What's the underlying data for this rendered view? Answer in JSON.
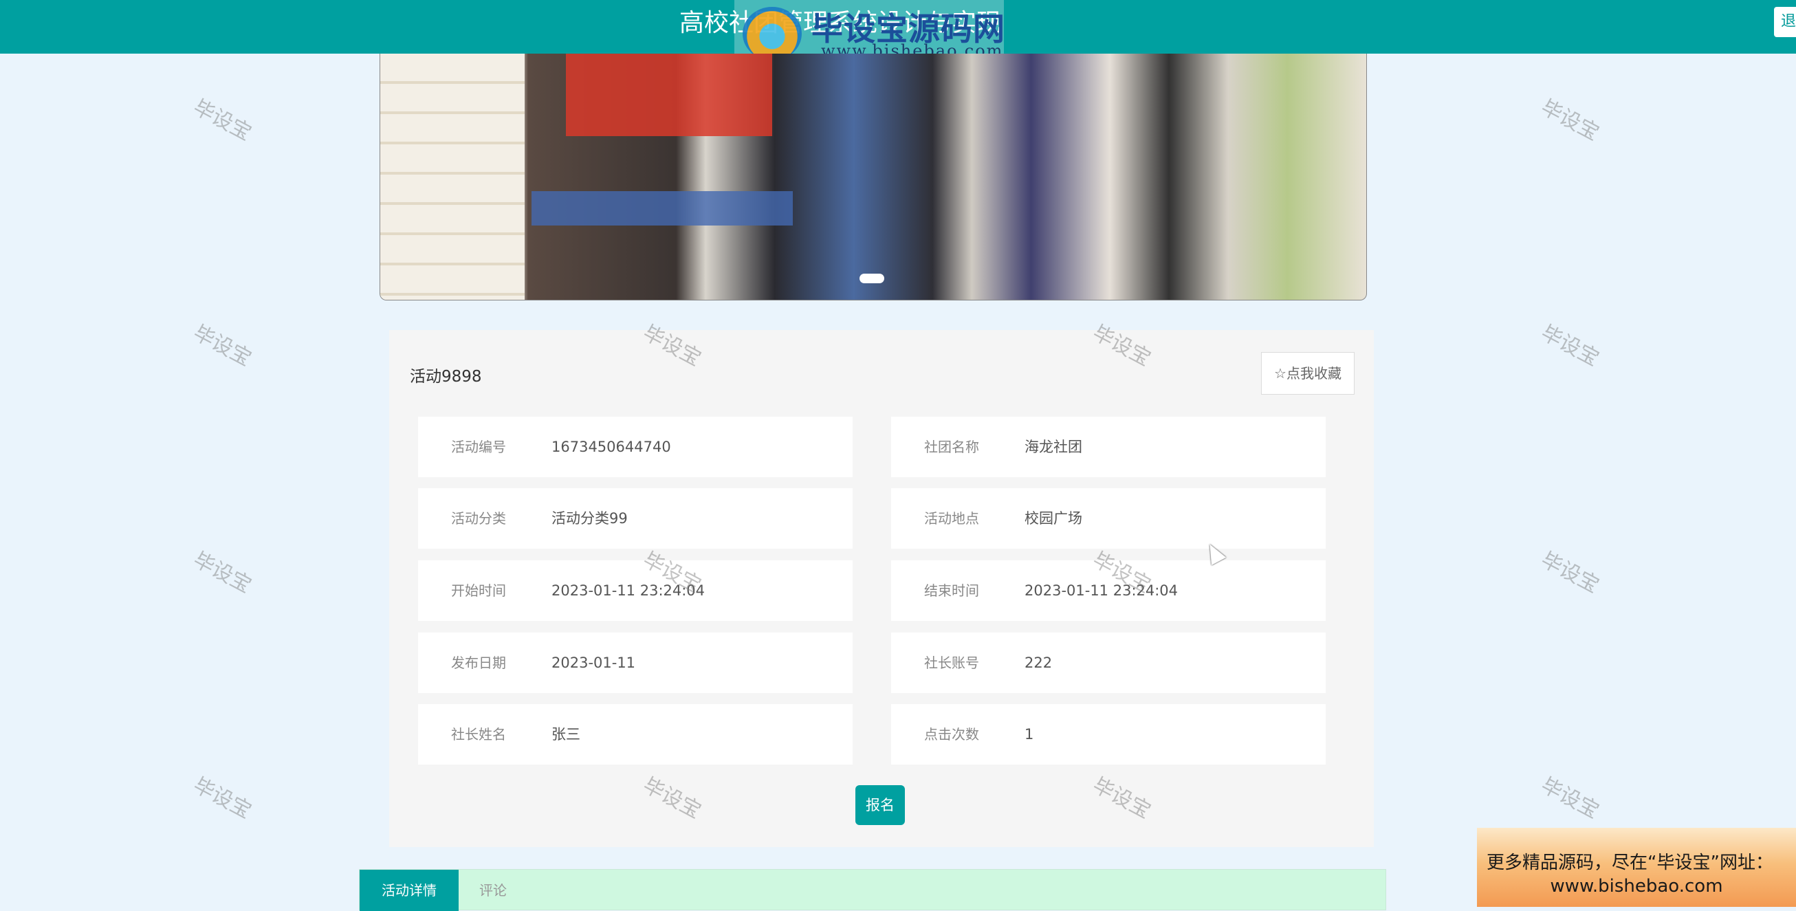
{
  "header": {
    "title": "高校社团管理系统设计与实现",
    "logout_label": "退出"
  },
  "logo_overlay": {
    "brand": "毕设宝源码网",
    "url": "www.bishebao.com"
  },
  "activity": {
    "title": "活动9898",
    "favorite_label": "☆点我收藏",
    "fields": [
      {
        "label": "活动编号",
        "value": "1673450644740"
      },
      {
        "label": "社团名称",
        "value": "海龙社团"
      },
      {
        "label": "活动分类",
        "value": "活动分类99"
      },
      {
        "label": "活动地点",
        "value": "校园广场"
      },
      {
        "label": "开始时间",
        "value": "2023-01-11 23:24:04"
      },
      {
        "label": "结束时间",
        "value": "2023-01-11 23:24:04"
      },
      {
        "label": "发布日期",
        "value": "2023-01-11"
      },
      {
        "label": "社长账号",
        "value": "222"
      },
      {
        "label": "社长姓名",
        "value": "张三"
      },
      {
        "label": "点击次数",
        "value": "1"
      }
    ],
    "signup_label": "报名"
  },
  "tabs": [
    {
      "label": "活动详情",
      "active": true
    },
    {
      "label": "评论",
      "active": false
    }
  ],
  "promo": {
    "line1": "更多精品源码，尽在“毕设宝”网址：",
    "line2": "www.bishebao.com"
  },
  "watermark_text": "毕设宝",
  "colors": {
    "primary": "#00a0a0",
    "page_bg": "#eaf4fc",
    "panel_bg": "#f5f5f5",
    "tab_bar_bg": "#cff8e0"
  }
}
